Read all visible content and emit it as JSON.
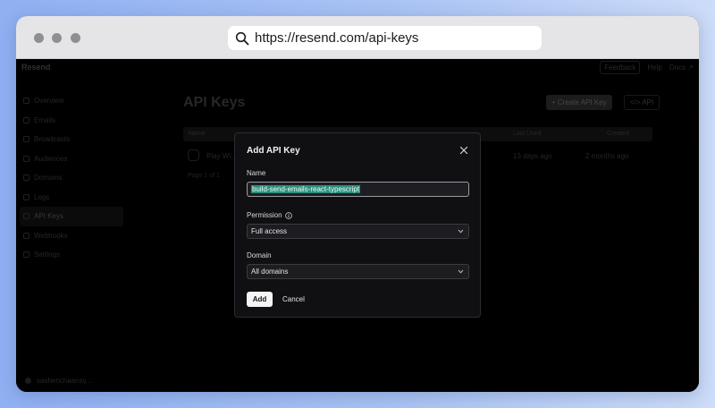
{
  "browser": {
    "url": "https://resend.com/api-keys",
    "search_icon": "search-icon"
  },
  "app": {
    "brand": "Resend",
    "top_buttons": [
      "Feedback",
      "Help",
      "Docs ↗"
    ],
    "sidebar": {
      "items": [
        {
          "label": "Overview",
          "icon": "grid-icon"
        },
        {
          "label": "Emails",
          "icon": "mail-icon"
        },
        {
          "label": "Broadcasts",
          "icon": "broadcast-icon"
        },
        {
          "label": "Audiences",
          "icon": "users-icon"
        },
        {
          "label": "Domains",
          "icon": "globe-icon"
        },
        {
          "label": "Logs",
          "icon": "logs-icon"
        },
        {
          "label": "API Keys",
          "icon": "key-icon"
        },
        {
          "label": "Webhooks",
          "icon": "webhook-icon"
        },
        {
          "label": "Settings",
          "icon": "gear-icon"
        }
      ],
      "account": "sashenchaansy..."
    },
    "page": {
      "title": "API Keys",
      "create_button": "+ Create API Key",
      "api_button": "</> API"
    },
    "table": {
      "columns": [
        "Name",
        "Last Used",
        "Created"
      ],
      "rows": [
        {
          "name": "Play Wi...",
          "last_used": "13 days ago",
          "created": "2 months ago"
        }
      ],
      "pager": "Page 1 of 1"
    }
  },
  "modal": {
    "title": "Add API Key",
    "name_label": "Name",
    "name_value": "build-send-emails-react-typescript",
    "permission_label": "Permission",
    "permission_value": "Full access",
    "domain_label": "Domain",
    "domain_value": "All domains",
    "add_button": "Add",
    "cancel_button": "Cancel"
  },
  "colors": {
    "background_gradient_start": "#8fb0f2",
    "background_gradient_end": "#cddcf8",
    "modal_bg": "#101013",
    "selection_highlight": "#2c8f7c"
  }
}
